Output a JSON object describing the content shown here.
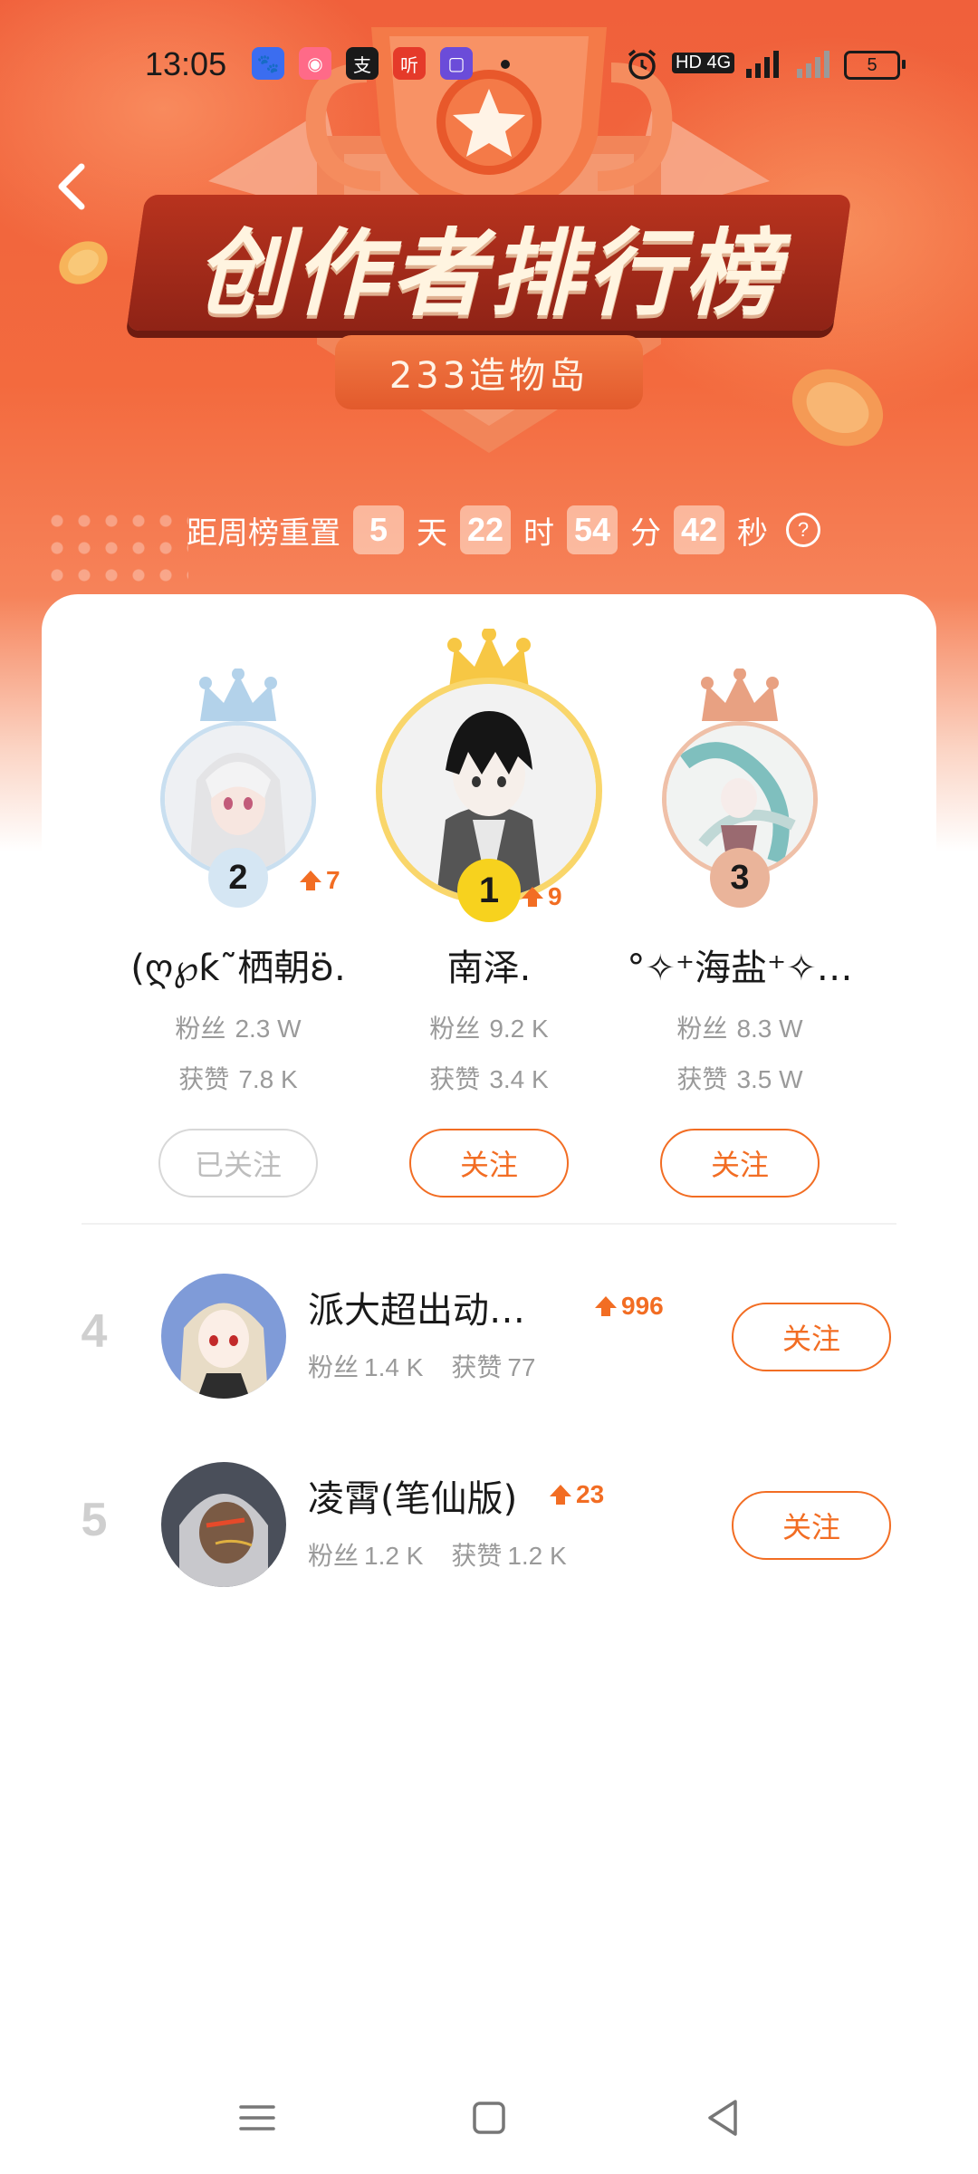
{
  "status_bar": {
    "time": "13:05",
    "apps": [
      {
        "icon": "baidu-icon",
        "color": "#3b6df0",
        "glyph": "🐾"
      },
      {
        "icon": "album-icon",
        "color": "#ff6a88",
        "glyph": "◉"
      },
      {
        "icon": "alipay-icon",
        "color": "#1a1a1a",
        "glyph": "支"
      },
      {
        "icon": "listen-icon",
        "color": "#e53a2a",
        "glyph": "听"
      },
      {
        "icon": "chat-icon",
        "color": "#6b4cd9",
        "glyph": "▢"
      }
    ],
    "network": "HD 4G",
    "battery": "5"
  },
  "header": {
    "title": "创作者排行榜",
    "subtitle": "233造物岛"
  },
  "countdown": {
    "label": "距周榜重置",
    "days": "5",
    "days_unit": "天",
    "hours": "22",
    "hours_unit": "时",
    "minutes": "54",
    "minutes_unit": "分",
    "seconds": "42",
    "seconds_unit": "秒",
    "help": "?"
  },
  "top3": [
    {
      "rank": "2",
      "name": "(ღ℘ƙ˜栖朝ʚ̈.",
      "trend": "7",
      "fans_label": "粉丝",
      "fans": "2.3 W",
      "likes_label": "获赞",
      "likes": "7.8 K",
      "button": "已关注",
      "followed": true
    },
    {
      "rank": "1",
      "name": "南泽.",
      "trend": "9",
      "fans_label": "粉丝",
      "fans": "9.2 K",
      "likes_label": "获赞",
      "likes": "3.4 K",
      "button": "关注",
      "followed": false
    },
    {
      "rank": "3",
      "name": "°✧⁺海盐⁺✧…",
      "trend": "",
      "fans_label": "粉丝",
      "fans": "8.3 W",
      "likes_label": "获赞",
      "likes": "3.5 W",
      "button": "关注",
      "followed": false
    }
  ],
  "list": [
    {
      "rank": "4",
      "name": "派大超出动…",
      "trend": "996",
      "fans_label": "粉丝",
      "fans": "1.4 K",
      "likes_label": "获赞",
      "likes": "77",
      "button": "关注"
    },
    {
      "rank": "5",
      "name": "凌霄(笔仙版)",
      "trend": "23",
      "fans_label": "粉丝",
      "fans": "1.2 K",
      "likes_label": "获赞",
      "likes": "1.2 K",
      "button": "关注"
    }
  ],
  "colors": {
    "accent": "#f26d23",
    "hero": "#f0603b",
    "gold": "#f7c744",
    "silver": "#a9c8e0",
    "bronze": "#e8a182"
  }
}
